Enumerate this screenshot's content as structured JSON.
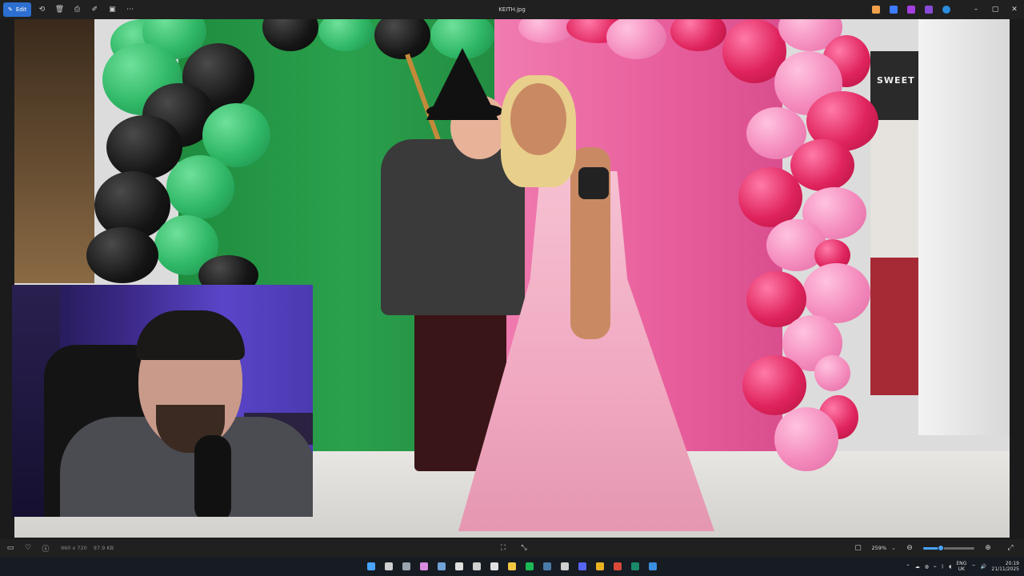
{
  "titlebar": {
    "edit_label": "Edit",
    "file_name": "KEITH.jpg",
    "tools": [
      "rotate-icon",
      "delete-icon",
      "print-icon",
      "edit-image-icon",
      "slideshow-icon",
      "more-icon"
    ],
    "app_icons": [
      {
        "name": "copilot-icon",
        "color": "#f0a04a"
      },
      {
        "name": "designer-icon",
        "color": "#3d7bff"
      },
      {
        "name": "clipchamp-icon",
        "color": "#a43ee0"
      },
      {
        "name": "purple-app-icon",
        "color": "#8a4ad8"
      },
      {
        "name": "onedrive-icon",
        "color": "#2b8ce0"
      }
    ]
  },
  "photo": {
    "sign_text": "SWEET"
  },
  "statusbar": {
    "dimensions": "960 x 720",
    "file_size": "97.9 KB",
    "zoom_level": "259%",
    "zoom_fraction": 0.35
  },
  "taskbar": {
    "apps": [
      {
        "name": "start-icon",
        "color": "#4aa3ff"
      },
      {
        "name": "task-view-icon",
        "color": "#cfcfcf"
      },
      {
        "name": "settings-icon",
        "color": "#9aa3b0"
      },
      {
        "name": "copilot-icon",
        "color": "#d98ae0"
      },
      {
        "name": "steam-icon",
        "color": "#6fa3d8"
      },
      {
        "name": "notepad-icon",
        "color": "#e0e0e0"
      },
      {
        "name": "github-icon",
        "color": "#cfcfcf"
      },
      {
        "name": "capcut-icon",
        "color": "#e0e0e0"
      },
      {
        "name": "file-explorer-icon",
        "color": "#f3c744"
      },
      {
        "name": "spotify-icon",
        "color": "#1db954"
      },
      {
        "name": "steam-client-icon",
        "color": "#4a7ba8"
      },
      {
        "name": "epic-games-icon",
        "color": "#cfcfcf"
      },
      {
        "name": "discord-icon",
        "color": "#5865f2"
      },
      {
        "name": "chrome-icon",
        "color": "#e9b320"
      },
      {
        "name": "chrome-profile-icon",
        "color": "#d94a3a"
      },
      {
        "name": "streamlabs-icon",
        "color": "#1a8a6a"
      },
      {
        "name": "photos-icon",
        "color": "#3a8ee0"
      }
    ],
    "lang_top": "ENG",
    "lang_bottom": "UK",
    "time": "20:19",
    "date": "21/11/2025"
  }
}
